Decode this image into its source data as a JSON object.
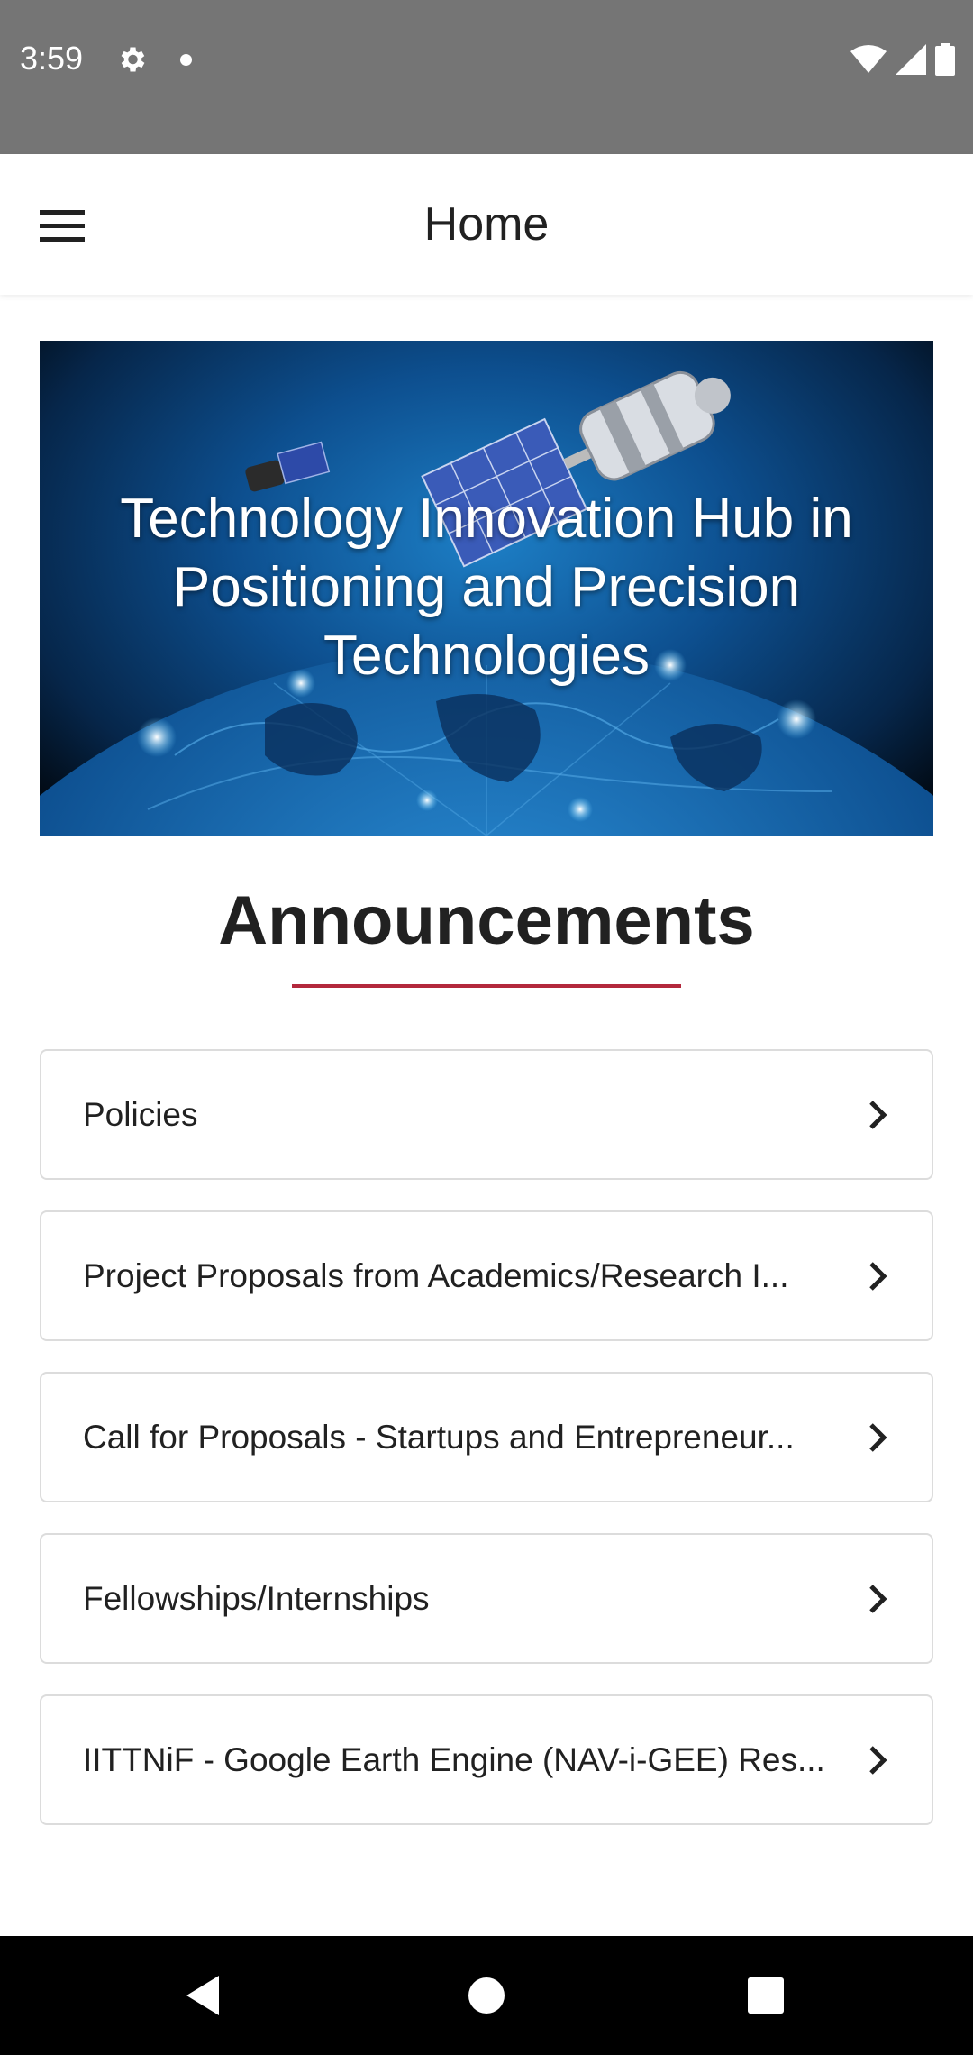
{
  "status_bar": {
    "time": "3:59",
    "icons": [
      "gear-icon",
      "notification-dot-icon",
      "wifi-icon",
      "signal-icon",
      "battery-icon"
    ]
  },
  "app_bar": {
    "title": "Home",
    "menu_icon": "hamburger-menu-icon"
  },
  "banner": {
    "title": "Technology Innovation Hub in Positioning and Precision Technologies"
  },
  "announcements": {
    "heading": "Announcements",
    "underline_color": "#b3283c",
    "items": [
      {
        "label": "Policies"
      },
      {
        "label": "Project Proposals from Academics/Research I..."
      },
      {
        "label": "Call for Proposals - Startups and Entrepreneur..."
      },
      {
        "label": "Fellowships/Internships"
      },
      {
        "label": "IITTNiF - Google Earth Engine (NAV-i-GEE) Res..."
      }
    ]
  },
  "nav_bar": {
    "buttons": [
      "back-icon",
      "home-icon",
      "recents-icon"
    ]
  },
  "colors": {
    "status_bar": "#757575",
    "accent": "#b3283c",
    "text": "#212121"
  }
}
